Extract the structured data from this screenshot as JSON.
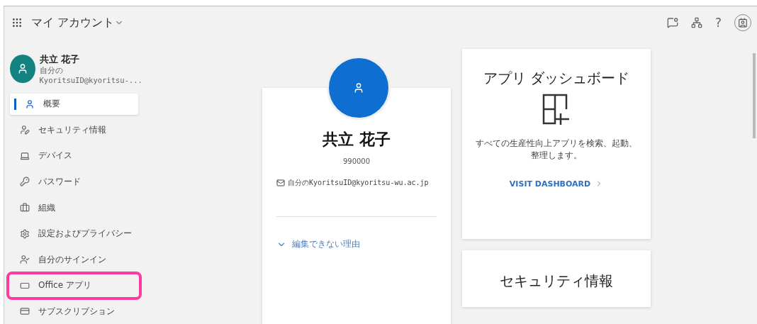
{
  "header": {
    "title": "マイ アカウント",
    "help": "?"
  },
  "user": {
    "name": "共立 花子",
    "email": "自分のKyoritsuID@kyoritsu-..."
  },
  "sidebar": {
    "items": [
      {
        "label": "概要",
        "selected": true,
        "highlighted": false
      },
      {
        "label": "セキュリティ情報",
        "selected": false,
        "highlighted": false
      },
      {
        "label": "デバイス",
        "selected": false,
        "highlighted": false
      },
      {
        "label": "パスワード",
        "selected": false,
        "highlighted": false
      },
      {
        "label": "組織",
        "selected": false,
        "highlighted": false
      },
      {
        "label": "設定およびプライバシー",
        "selected": false,
        "highlighted": false
      },
      {
        "label": "自分のサインイン",
        "selected": false,
        "highlighted": false
      },
      {
        "label": "Office アプリ",
        "selected": false,
        "highlighted": true
      },
      {
        "label": "サブスクリプション",
        "selected": false,
        "highlighted": false
      }
    ]
  },
  "profile_card": {
    "name": "共立 花子",
    "id": "990000",
    "email": "自分のKyoritsuID@kyoritsu-wu.ac.jp",
    "why_link": "編集できない理由"
  },
  "dashboard_card": {
    "title": "アプリ ダッシュボード",
    "description": "すべての生産性向上アプリを検索、起動、整理します。",
    "link": "VISIT DASHBOARD"
  },
  "security_card": {
    "title": "セキュリティ情報"
  }
}
